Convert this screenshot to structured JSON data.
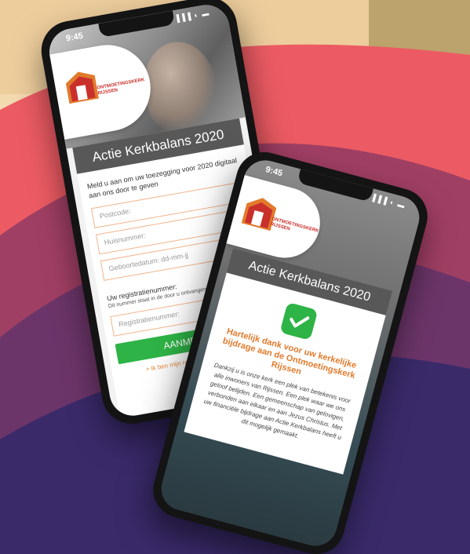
{
  "phone1": {
    "status_time": "9:45",
    "status_icons": "▐▐▐ ◐ ▬",
    "logo_text": "ONTMOETINGSKERK RIJSSEN",
    "title": "Actie Kerkbalans 2020",
    "intro": "Meld u aan om uw toezegging voor 2020 digitaal aan ons door te geven",
    "fields": {
      "postcode": "Postcode:",
      "huisnummer": "Huisnummer:",
      "geboortedatum": "Geboortedatum: dd-mm-jj"
    },
    "reg_label": "Uw registratienummer:",
    "reg_hint": "Dit nummer staat in de door u ontvangen mail",
    "reg_placeholder": "Registratienummer:",
    "submit_label": "AANMELDEN",
    "lost_link": "> Ik ben mijn registratienummer kwijt"
  },
  "phone2": {
    "status_time": "9:45",
    "status_icons": "▐▐▐ ◐ ▬",
    "logo_text": "ONTMOETINGSKERK RIJSSEN",
    "title": "Actie Kerkbalans 2020",
    "thanks": "Hartelijk dank voor uw kerkelijke bijdrage aan de Ontmoetingskerk Rijssen",
    "body": "Dankzij u is onze kerk een plek van betekenis voor alle inwoners van Rijssen. Een plek waar we ons geloof belijden. Een gemeenschap van gelovigen, verbonden aan elkaar en aan Jezus Christus. Met uw financiële bijdrage aan Actie Kerkbalans heeft u dit mogelijk gemaakt."
  },
  "colors": {
    "accent_green": "#2eb346",
    "accent_orange": "#e27a2c",
    "header_gray": "#585858",
    "wave_red": "#ec5b63",
    "wave_purple": "#7b3b6b",
    "wave_dark": "#3a2a6a"
  }
}
